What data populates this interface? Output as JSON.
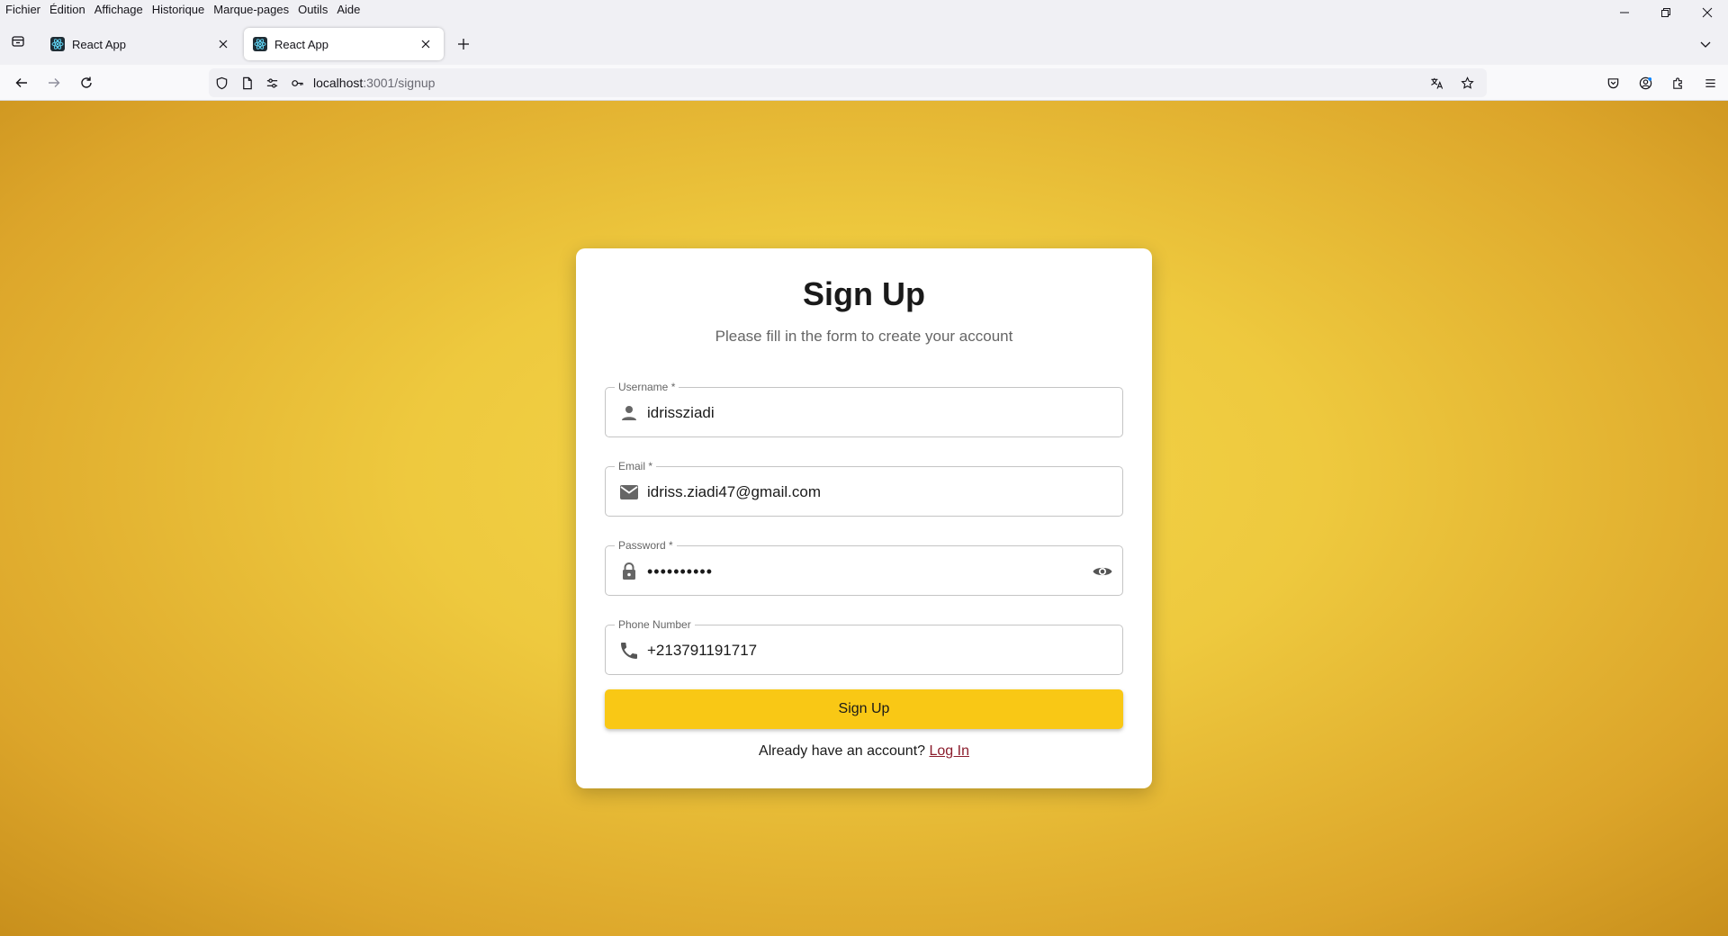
{
  "menu": {
    "items": [
      "Fichier",
      "Édition",
      "Affichage",
      "Historique",
      "Marque-pages",
      "Outils",
      "Aide"
    ]
  },
  "tabs": [
    {
      "title": "React App",
      "active": false
    },
    {
      "title": "React App",
      "active": true
    }
  ],
  "address": {
    "host": "localhost",
    "path": ":3001/signup"
  },
  "page": {
    "title": "Sign Up",
    "subtitle": "Please fill in the form to create your account",
    "fields": {
      "username": {
        "label": "Username *",
        "value": "idrissziadi",
        "icon": "person-icon"
      },
      "email": {
        "label": "Email *",
        "value": "idriss.ziadi47@gmail.com",
        "icon": "mail-icon"
      },
      "password": {
        "label": "Password *",
        "value": "••••••••••",
        "icon": "lock-icon"
      },
      "phone": {
        "label": "Phone Number",
        "value": "+213791191717",
        "icon": "phone-icon"
      }
    },
    "submit_label": "Sign Up",
    "login_prompt": "Already have an account?",
    "login_link": "Log In"
  },
  "colors": {
    "accent": "#f9c815",
    "background": "#eec93e",
    "link": "#8b1c2c"
  }
}
